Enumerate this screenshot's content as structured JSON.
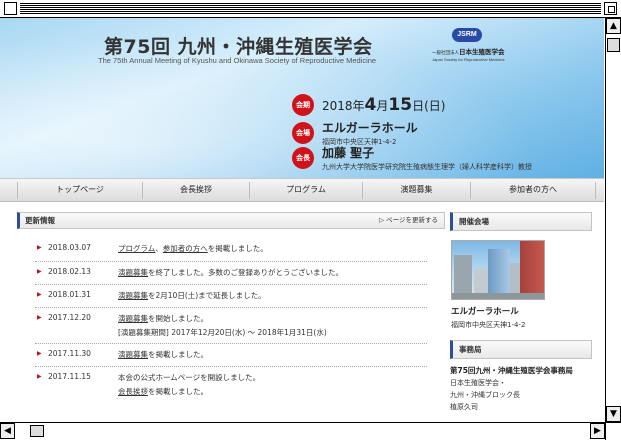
{
  "header": {
    "title": "第75回 九州・沖縄生殖医学会",
    "subtitle": "The 75th Annual Meeting of Kyushu and Okinawa Society of Reproductive Medicine",
    "society": {
      "badge": "JSRM",
      "prefix": "一般社団法人",
      "name": "日本生殖医学会",
      "english": "Japan Society for Reproductive Medicine"
    }
  },
  "info": {
    "date": {
      "badge": "会期",
      "year": "2018年",
      "month": "4",
      "month_unit": "月",
      "day": "15",
      "day_unit": "日",
      "weekday": "(日)"
    },
    "venue": {
      "badge": "会場",
      "name": "エルガーラホール",
      "address": "福岡市中央区天神1-4-2"
    },
    "chair": {
      "badge": "会長",
      "name": "加藤 聖子",
      "affiliation": "九州大学大学院医学研究院生殖病態生理学（婦人科学産科学）教授"
    }
  },
  "nav": {
    "items": [
      "トップページ",
      "会長挨拶",
      "プログラム",
      "演題募集",
      "参加者の方へ"
    ]
  },
  "news": {
    "title": "更新情報",
    "more": "▷ ページを更新する",
    "items": [
      {
        "date": "2018.03.07",
        "pre": "",
        "link1": "プログラム",
        "mid": "、",
        "link2": "参加者の方へ",
        "post": "を掲載しました。",
        "line2": ""
      },
      {
        "date": "2018.02.13",
        "pre": "",
        "link1": "演題募集",
        "mid": "",
        "link2": "",
        "post": "を終了しました。多数のご登録ありがとうございました。",
        "line2": ""
      },
      {
        "date": "2018.01.31",
        "pre": "",
        "link1": "演題募集",
        "mid": "",
        "link2": "",
        "post": "を2月10日(土)まで延長しました。",
        "line2": ""
      },
      {
        "date": "2017.12.20",
        "pre": "",
        "link1": "演題募集",
        "mid": "",
        "link2": "",
        "post": "を開始しました。",
        "line2": "[演題募集期間] 2017年12月20日(水) ～ 2018年1月31日(水)"
      },
      {
        "date": "2017.11.30",
        "pre": "",
        "link1": "演題募集",
        "mid": "",
        "link2": "",
        "post": "を掲載しました。",
        "line2": ""
      },
      {
        "date": "2017.11.15",
        "pre": "本会の公式ホームページを開設しました。",
        "link1": "",
        "mid": "",
        "link2": "",
        "post": "",
        "line2_link": "会長挨拶",
        "line2": "を掲載しました。"
      }
    ]
  },
  "sidebar": {
    "venue_title": "開催会場",
    "venue_name": "エルガーラホール",
    "venue_address": "福岡市中央区天神1-4-2",
    "office_title": "事務局",
    "office_name": "第75回九州・沖縄生殖医学会事務局",
    "office_lines": [
      "日本生殖医学会・",
      "九州・沖縄ブロック長",
      "植原久司"
    ]
  },
  "colors": {
    "accent_red": "#d0121b",
    "nav_blue": "#2c4ea0",
    "header_blue": "#8ec9ee"
  }
}
